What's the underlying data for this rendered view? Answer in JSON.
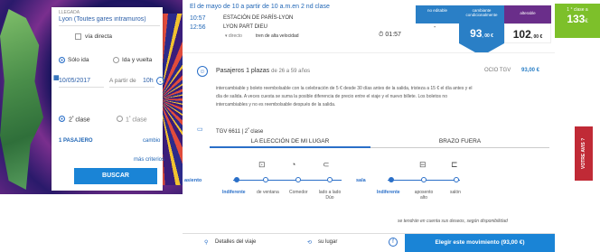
{
  "form": {
    "arrival_label": "LLEGADA",
    "arrival_value": "Lyon (Toutes gares intramuros)",
    "direct_label": "vía directa",
    "one_way_label": "Sólo ida",
    "round_trip_label": "Ida y vuelta",
    "date_value": "10/05/2017",
    "time_label": "A partir de",
    "time_value": "10h",
    "class2_label": "2",
    "class2_suffix": "clase",
    "class1_label": "1",
    "class1_suffix": "clase",
    "passengers_label": "1 PASAJERO",
    "change_label": "cambio",
    "more_criteria_label": "más criterios",
    "search_button": "BUSCAR"
  },
  "header": {
    "date_line": "El de mayo de 10 a partir de 10 a.m.en 2 nd clase",
    "time_top": "10:57",
    "time": "12:56",
    "station_top": "ESTACIÓN DE PARÍS-LYON",
    "station": "LYON PART DIEU",
    "direct": "directo",
    "train_type": "tren de alta velocidad",
    "duration": "01:57",
    "dash": "-",
    "tag_not_editable": "no editable",
    "tag_changeable": "cambiante condicionalmente",
    "tag_alterable": "alterable",
    "price_main": "93",
    "price_main_suffix": ", 00 €",
    "price_alt": "102",
    "price_alt_suffix": ", 00 €",
    "first_class_label": "1 ° clase a",
    "first_class_price": "133",
    "first_class_suffix": "€"
  },
  "detail": {
    "pax_title": "Pasajeros 1 plazas",
    "pax_age": "de 26 a 59 años",
    "ocio_label": "OCIO TGV",
    "ocio_price": "93,00 €",
    "conditions_1": "intercambiable y boleto reembolsable con la celebración de 5 € desde 30 días antes de la salida, tristeza a 15 € el día antes y el",
    "conditions_2": "día de salida. A veces cuesta se suma la posible diferencia de precio entre el viaje y el nuevo billete. Los boletos no",
    "conditions_3": "intercambiables y no es reembolsable después de la salida.",
    "train_label": "TGV 6611 | 2",
    "train_suffix": "clase",
    "tab_seat": "LA ELECCIÓN DE MI LUGAR",
    "tab_outbound": "BRAZO FUERA",
    "seat_label": "asiento",
    "seat_options": [
      "Indiferente",
      "de ventana",
      "Comedor",
      "lado a lado Dúo"
    ],
    "room_label": "sala",
    "room_options": [
      "Indiferente",
      "aposento alto",
      "salón"
    ],
    "note": "se tendrán en cuenta sus deseos, según disponibilidad",
    "footer_details": "Detalles del viaje",
    "footer_place": "su lugar",
    "footer_select": "Elegir este movimiento (93,00 €)"
  },
  "side_tab": "VOTRE AVIS ?",
  "colors": {
    "accent_blue": "#1a84d6",
    "price_blue": "#2a7fc6",
    "alterable_purple": "#6a2e8a",
    "first_class_green": "#7dc02a",
    "side_red": "#c02a36"
  }
}
